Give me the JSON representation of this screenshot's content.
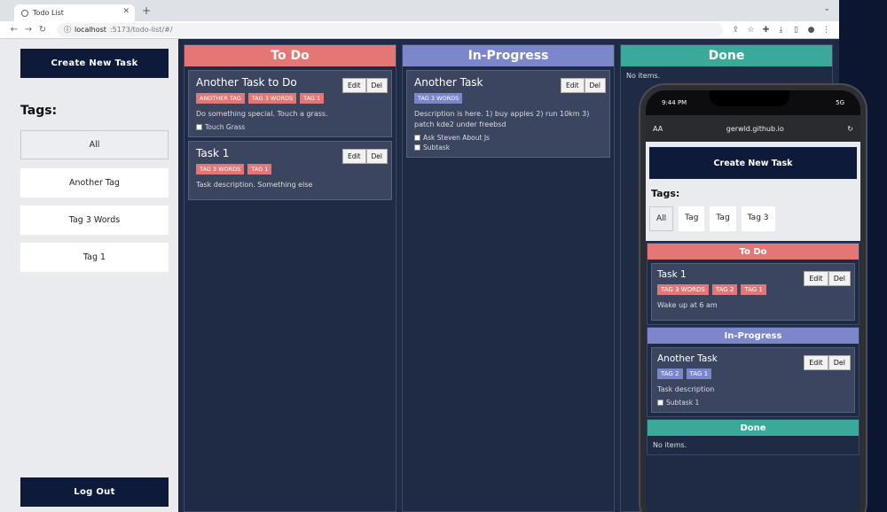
{
  "browser": {
    "tab_title": "Todo List",
    "new_tab": "+",
    "url_host": "localhost",
    "url_path": ":5173/todo-list/#/"
  },
  "sidebar": {
    "create_label": "Create New Task",
    "tags_heading": "Tags:",
    "tags": [
      "All",
      "Another Tag",
      "Tag 3 Words",
      "Tag 1"
    ],
    "logout_label": "Log Out"
  },
  "columns": {
    "todo": {
      "title": "To Do",
      "cards": [
        {
          "title": "Another Task to Do",
          "tags": [
            "Another Tag",
            "Tag 3 Words",
            "Tag 1"
          ],
          "description": "Do something special. Touch a grass.",
          "subtasks": [
            "Touch Grass"
          ]
        },
        {
          "title": "Task 1",
          "tags": [
            "Tag 3 Words",
            "Tag 1"
          ],
          "description": "Task description. Something else",
          "subtasks": []
        }
      ]
    },
    "progress": {
      "title": "In-Progress",
      "cards": [
        {
          "title": "Another Task",
          "tags": [
            "Tag 3 Words"
          ],
          "description": "Description is here. 1) buy apples 2) run 10km 3) patch kde2 under freebsd",
          "subtasks": [
            "Ask Steven About Js",
            "Subtask"
          ]
        }
      ]
    },
    "done": {
      "title": "Done",
      "empty": "No items."
    }
  },
  "card_actions": {
    "edit": "Edit",
    "delete": "Del"
  },
  "phone": {
    "time": "9:44 PM",
    "signal": "5G",
    "url": "gerwld.github.io",
    "aa": "AA",
    "create_label": "Create New Task",
    "tags_heading": "Tags:",
    "tags": [
      "All",
      "Tag",
      "Tag",
      "Tag 3"
    ],
    "todo": {
      "title": "To Do",
      "card_title": "Task 1",
      "tags": [
        "Tag 3 Words",
        "Tag 2",
        "Tag 1"
      ],
      "description": "Wake up at 6 am"
    },
    "progress": {
      "title": "In-Progress",
      "card_title": "Another Task",
      "tags": [
        "Tag 2",
        "Tag 1"
      ],
      "description": "Task description",
      "subtask": "Subtask 1"
    },
    "done": {
      "title": "Done",
      "empty": "No items."
    }
  },
  "colors": {
    "todo": "#e47775",
    "progress": "#7b87ca",
    "done": "#3aa99a",
    "navy": "#0d1a3a"
  }
}
